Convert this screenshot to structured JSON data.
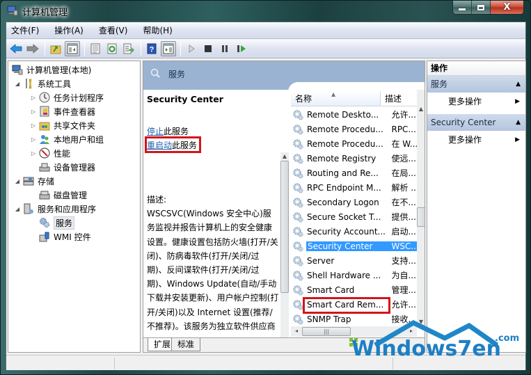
{
  "window": {
    "title": "计算机管理",
    "controls": {
      "minimize": "minimize",
      "maximize": "maximize",
      "close": "X"
    }
  },
  "menubar": {
    "items": [
      "文件(F)",
      "操作(A)",
      "查看(V)",
      "帮助(H)"
    ]
  },
  "toolbar": {
    "buttons": [
      "back-arrow-icon",
      "forward-arrow-icon",
      "up-folder-icon",
      "show-hide-tree-icon",
      "properties-icon",
      "refresh-icon",
      "export-list-icon",
      "help-icon",
      "show-hide-action-pane-icon",
      "start-service-icon",
      "stop-service-icon",
      "pause-service-icon",
      "restart-service-icon"
    ]
  },
  "tree": {
    "items": [
      {
        "label": "计算机管理(本地)",
        "level": 0,
        "expander": "",
        "icon": "computer-management-icon"
      },
      {
        "label": "系统工具",
        "level": 1,
        "expander": "expanded",
        "icon": "system-tools-icon"
      },
      {
        "label": "任务计划程序",
        "level": 2,
        "expander": "collapsed",
        "icon": "task-scheduler-icon"
      },
      {
        "label": "事件查看器",
        "level": 2,
        "expander": "collapsed",
        "icon": "event-viewer-icon"
      },
      {
        "label": "共享文件夹",
        "level": 2,
        "expander": "collapsed",
        "icon": "shared-folders-icon"
      },
      {
        "label": "本地用户和组",
        "level": 2,
        "expander": "collapsed",
        "icon": "local-users-icon"
      },
      {
        "label": "性能",
        "level": 2,
        "expander": "collapsed",
        "icon": "performance-icon"
      },
      {
        "label": "设备管理器",
        "level": 2,
        "expander": "",
        "icon": "device-manager-icon"
      },
      {
        "label": "存储",
        "level": 1,
        "expander": "expanded",
        "icon": "storage-icon"
      },
      {
        "label": "磁盘管理",
        "level": 2,
        "expander": "",
        "icon": "disk-management-icon"
      },
      {
        "label": "服务和应用程序",
        "level": 1,
        "expander": "expanded",
        "icon": "services-apps-icon"
      },
      {
        "label": "服务",
        "level": 2,
        "expander": "",
        "icon": "services-icon",
        "selected": true
      },
      {
        "label": "WMI 控件",
        "level": 2,
        "expander": "",
        "icon": "wmi-control-icon"
      }
    ]
  },
  "middle": {
    "header_title": "服务",
    "service_name": "Security Center",
    "stop_link": "停止",
    "stop_suffix": "此服务",
    "restart_link": "重启动",
    "restart_suffix": "此服务",
    "description_label": "描述:",
    "description": "WSCSVC(Windows 安全中心)服务监视并报告计算机上的安全健康设置。健康设置包括防火墙(打开/关闭)、防病毒软件(打开/关闭/过期)、反间谍软件(打开/关闭/过期)、Windows Update(自动/手动下载并安装更新)、用户帐户控制(打开/关闭)以及 Internet 设置(推荐/不推荐)。该服务为独立软件供应商提供 COM API 以便向安全中心服务注册并记录其产品的状态。操作中心(AC) UI 使用该服务在",
    "columns": {
      "name": "名称",
      "desc": "描述"
    },
    "services": [
      {
        "name": "Remote Deskto...",
        "desc": "允许..."
      },
      {
        "name": "Remote Procedu...",
        "desc": "RPC..."
      },
      {
        "name": "Remote Procedu...",
        "desc": "在 W..."
      },
      {
        "name": "Remote Registry",
        "desc": "使远..."
      },
      {
        "name": "Routing and Re...",
        "desc": "在局..."
      },
      {
        "name": "RPC Endpoint M...",
        "desc": "解析 ..."
      },
      {
        "name": "Secondary Logon",
        "desc": "在不..."
      },
      {
        "name": "Secure Socket T...",
        "desc": "提供..."
      },
      {
        "name": "Security Account...",
        "desc": "启动..."
      },
      {
        "name": "Security Center",
        "desc": "WSC...",
        "selected": true
      },
      {
        "name": "Server",
        "desc": "支持..."
      },
      {
        "name": "Shell Hardware ...",
        "desc": "为自..."
      },
      {
        "name": "Smart Card",
        "desc": "管理..."
      },
      {
        "name": "Smart Card Rem...",
        "desc": "允许..."
      },
      {
        "name": "SNMP Trap",
        "desc": "接收..."
      }
    ],
    "tabs": [
      "扩展",
      "标准"
    ]
  },
  "actions": {
    "title": "操作",
    "groups": [
      {
        "label": "服务",
        "item": "更多操作"
      },
      {
        "label": "Security Center",
        "item": "更多操作"
      }
    ]
  },
  "watermark": {
    "text": "Windows7en",
    "suffix": ".com"
  },
  "colors": {
    "selection": "#3399ff",
    "highlight_box": "#d4141a",
    "link": "#1f5fb0",
    "header_band": "#9bb3d2"
  }
}
